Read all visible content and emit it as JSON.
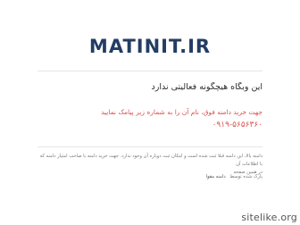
{
  "site": {
    "domain_title": "MATINIT.IR",
    "inactive_message": "این وبگاه هیچگونه فعالیتی ندارد",
    "contact_message": "جهت خرید دامنه فوق، نام آن را به شماره زیر پیامک نمایید",
    "phone": "۰۹۱۹-۵۶۵۶۳۶۰"
  },
  "footer": {
    "disclaimer_line1": "دامنه بالا، این دامنه قبلا ثبت شده است و امکان ثبت دوباره آن وجود ندارد. جهت خرید دامنه با صاحب امتیاز دامنه که با اطلاعات آن",
    "disclaimer_line2": "در همین صفحه",
    "links": [
      "پارک شده توسط",
      "دامنه مقوا"
    ]
  },
  "watermark": "sitelike.org"
}
